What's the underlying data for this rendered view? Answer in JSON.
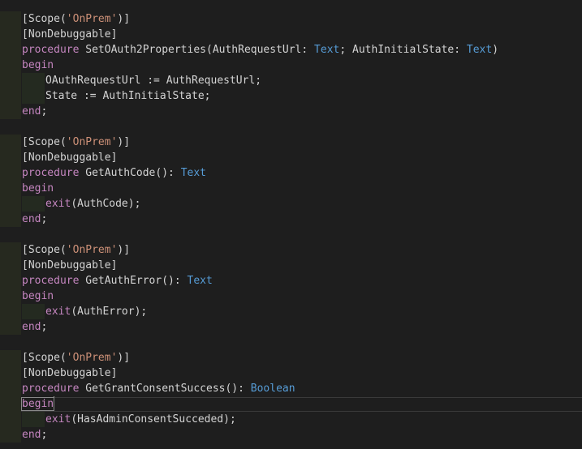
{
  "editor": {
    "lines": [
      {
        "indent": false,
        "tokens": [
          {
            "t": "[Scope(",
            "c": "default"
          },
          {
            "t": "'OnPrem'",
            "c": "string"
          },
          {
            "t": ")]",
            "c": "default"
          }
        ]
      },
      {
        "indent": false,
        "tokens": [
          {
            "t": "[NonDebuggable]",
            "c": "default"
          }
        ]
      },
      {
        "indent": false,
        "tokens": [
          {
            "t": "procedure",
            "c": "keyword"
          },
          {
            "t": " SetOAuth2Properties(AuthRequestUrl: ",
            "c": "default"
          },
          {
            "t": "Text",
            "c": "type"
          },
          {
            "t": "; AuthInitialState: ",
            "c": "default"
          },
          {
            "t": "Text",
            "c": "type"
          },
          {
            "t": ")",
            "c": "default"
          }
        ]
      },
      {
        "indent": false,
        "tokens": [
          {
            "t": "begin",
            "c": "keyword"
          }
        ]
      },
      {
        "indent": true,
        "tokens": [
          {
            "t": "OAuthRequestUrl := AuthRequestUrl;",
            "c": "default"
          }
        ]
      },
      {
        "indent": true,
        "tokens": [
          {
            "t": "State := AuthInitialState;",
            "c": "default"
          }
        ]
      },
      {
        "indent": false,
        "tokens": [
          {
            "t": "end",
            "c": "keyword"
          },
          {
            "t": ";",
            "c": "default"
          }
        ]
      },
      {
        "empty": true,
        "tokens": []
      },
      {
        "indent": false,
        "tokens": [
          {
            "t": "[Scope(",
            "c": "default"
          },
          {
            "t": "'OnPrem'",
            "c": "string"
          },
          {
            "t": ")]",
            "c": "default"
          }
        ]
      },
      {
        "indent": false,
        "tokens": [
          {
            "t": "[NonDebuggable]",
            "c": "default"
          }
        ]
      },
      {
        "indent": false,
        "tokens": [
          {
            "t": "procedure",
            "c": "keyword"
          },
          {
            "t": " GetAuthCode(): ",
            "c": "default"
          },
          {
            "t": "Text",
            "c": "type"
          }
        ]
      },
      {
        "indent": false,
        "tokens": [
          {
            "t": "begin",
            "c": "keyword"
          }
        ]
      },
      {
        "indent": true,
        "tokens": [
          {
            "t": "exit",
            "c": "keyword"
          },
          {
            "t": "(AuthCode);",
            "c": "default"
          }
        ]
      },
      {
        "indent": false,
        "tokens": [
          {
            "t": "end",
            "c": "keyword"
          },
          {
            "t": ";",
            "c": "default"
          }
        ]
      },
      {
        "empty": true,
        "tokens": []
      },
      {
        "indent": false,
        "tokens": [
          {
            "t": "[Scope(",
            "c": "default"
          },
          {
            "t": "'OnPrem'",
            "c": "string"
          },
          {
            "t": ")]",
            "c": "default"
          }
        ]
      },
      {
        "indent": false,
        "tokens": [
          {
            "t": "[NonDebuggable]",
            "c": "default"
          }
        ]
      },
      {
        "indent": false,
        "tokens": [
          {
            "t": "procedure",
            "c": "keyword"
          },
          {
            "t": " GetAuthError(): ",
            "c": "default"
          },
          {
            "t": "Text",
            "c": "type"
          }
        ]
      },
      {
        "indent": false,
        "tokens": [
          {
            "t": "begin",
            "c": "keyword"
          }
        ]
      },
      {
        "indent": true,
        "tokens": [
          {
            "t": "exit",
            "c": "keyword"
          },
          {
            "t": "(AuthError);",
            "c": "default"
          }
        ]
      },
      {
        "indent": false,
        "tokens": [
          {
            "t": "end",
            "c": "keyword"
          },
          {
            "t": ";",
            "c": "default"
          }
        ]
      },
      {
        "empty": true,
        "tokens": []
      },
      {
        "indent": false,
        "tokens": [
          {
            "t": "[Scope(",
            "c": "default"
          },
          {
            "t": "'OnPrem'",
            "c": "string"
          },
          {
            "t": ")]",
            "c": "default"
          }
        ]
      },
      {
        "indent": false,
        "tokens": [
          {
            "t": "[NonDebuggable]",
            "c": "default"
          }
        ]
      },
      {
        "indent": false,
        "tokens": [
          {
            "t": "procedure",
            "c": "keyword"
          },
          {
            "t": " GetGrantConsentSuccess(): ",
            "c": "default"
          },
          {
            "t": "Boolean",
            "c": "type"
          }
        ]
      },
      {
        "indent": false,
        "current": true,
        "tokens": [
          {
            "t": "begin",
            "c": "keyword"
          }
        ]
      },
      {
        "indent": true,
        "tokens": [
          {
            "t": "exit",
            "c": "keyword"
          },
          {
            "t": "(HasAdminConsentSucceded);",
            "c": "default"
          }
        ]
      },
      {
        "indent": false,
        "tokens": [
          {
            "t": "end",
            "c": "keyword"
          },
          {
            "t": ";",
            "c": "default"
          }
        ]
      }
    ]
  },
  "colors": {
    "background": "#1e1e1e",
    "default": "#d4d4d4",
    "keyword": "#c586c0",
    "string": "#ce9178",
    "type": "#569cd6"
  }
}
